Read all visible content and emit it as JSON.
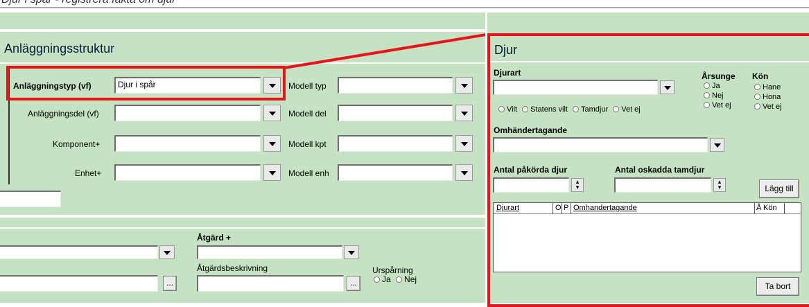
{
  "top_text": "Djur i spår - registrera fakta om djur",
  "left": {
    "title": "Anläggningsstruktur",
    "rows": [
      {
        "label": "Anläggningstyp (vf)",
        "value": "Djur i spår",
        "model_label": "Modell typ",
        "model_value": ""
      },
      {
        "label": "Anläggningsdel (vf)",
        "value": "",
        "model_label": "Modell del",
        "model_value": ""
      },
      {
        "label": "Komponent+",
        "value": "",
        "model_label": "Modell kpt",
        "model_value": ""
      },
      {
        "label": "Enhet+",
        "value": "",
        "model_label": "Modell enh",
        "model_value": ""
      }
    ],
    "atgard_label": "Åtgärd +",
    "atgard_beskrivning_label": "Åtgärdsbeskrivning",
    "ellipsis": "...",
    "ursparning": {
      "label": "Urspårning",
      "options": [
        "Ja",
        "Nej"
      ]
    }
  },
  "djur": {
    "title": "Djur",
    "djurart_label": "Djurart",
    "djurart_options": [
      "Vilt",
      "Statens vilt",
      "Tamdjur",
      "Vet ej"
    ],
    "arsunge": {
      "label": "Årsunge",
      "options": [
        "Ja",
        "Nej",
        "Vet ej"
      ]
    },
    "kon": {
      "label": "Kön",
      "options": [
        "Hane",
        "Hona",
        "Vet ej"
      ]
    },
    "omhandertagande_label": "Omhändertagande",
    "antal_pakorda_label": "Antal påkörda djur",
    "antal_oskadda_label": "Antal oskadda tamdjur",
    "lagg_till": "Lägg till",
    "ta_bort": "Ta bort",
    "table_headers": [
      "Djurart",
      "O",
      "P",
      "Omhandertagande",
      "Å",
      "Kön"
    ]
  },
  "colors": {
    "panel": "#c5e3c3",
    "highlight": "#e8141c"
  }
}
